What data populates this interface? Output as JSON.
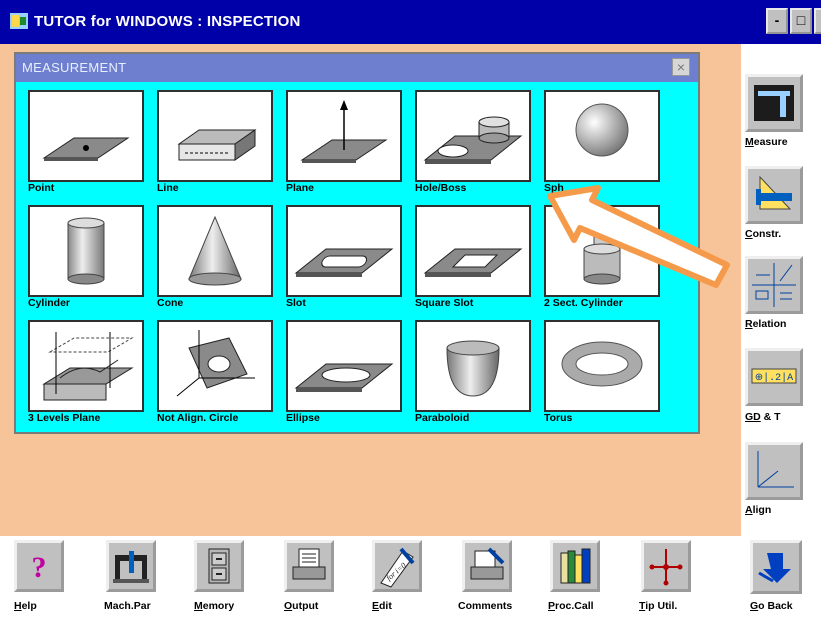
{
  "window": {
    "title": "TUTOR for WINDOWS : INSPECTION",
    "minimize_label": "-",
    "maximize_label": "□",
    "close_label": "×"
  },
  "measurement_panel": {
    "title": "MEASUREMENT",
    "close_label": "×",
    "tiles": [
      {
        "label": "Point",
        "icon": "point-icon"
      },
      {
        "label": "Line",
        "icon": "line-icon"
      },
      {
        "label": "Plane",
        "icon": "plane-icon"
      },
      {
        "label": "Hole/Boss",
        "icon": "hole-boss-icon"
      },
      {
        "label": "Sph",
        "icon": "sphere-icon"
      },
      {
        "label": "Cylinder",
        "icon": "cylinder-icon"
      },
      {
        "label": "Cone",
        "icon": "cone-icon"
      },
      {
        "label": "Slot",
        "icon": "slot-icon"
      },
      {
        "label": "Square Slot",
        "icon": "square-slot-icon"
      },
      {
        "label": "2 Sect. Cylinder",
        "icon": "two-section-cylinder-icon"
      },
      {
        "label": "3 Levels Plane",
        "icon": "three-levels-plane-icon"
      },
      {
        "label": "Not Align. Circle",
        "icon": "not-aligned-circle-icon"
      },
      {
        "label": "Ellipse",
        "icon": "ellipse-icon"
      },
      {
        "label": "Paraboloid",
        "icon": "paraboloid-icon"
      },
      {
        "label": "Torus",
        "icon": "torus-icon"
      }
    ]
  },
  "right_toolbar": [
    {
      "first": "M",
      "rest": "easure",
      "icon": "caliper-icon"
    },
    {
      "first": "C",
      "rest": "onstr.",
      "icon": "set-square-ruler-icon"
    },
    {
      "first": "R",
      "rest": "elation",
      "icon": "relation-icon"
    },
    {
      "first": "GD",
      "rest": " & T",
      "icon": "gdt-frame-icon",
      "frame_text": "⊕|.2|A"
    },
    {
      "first": "A",
      "rest": "lign",
      "icon": "axes-icon"
    }
  ],
  "bottom_toolbar": [
    {
      "first": "H",
      "rest": "elp",
      "icon": "question-icon"
    },
    {
      "first": "",
      "rest": "Mach.Par",
      "icon": "cmm-machine-icon"
    },
    {
      "first": "M",
      "rest": "emory",
      "icon": "filing-cabinet-icon"
    },
    {
      "first": "O",
      "rest": "utput",
      "icon": "printer-icon"
    },
    {
      "first": "E",
      "rest": "dit",
      "icon": "pen-paper-icon",
      "note": "for i=0"
    },
    {
      "first": "",
      "rest": "Comments",
      "icon": "comment-printer-icon"
    },
    {
      "first": "P",
      "rest": "roc.Call",
      "icon": "books-icon"
    },
    {
      "first": "T",
      "rest": "ip Util.",
      "icon": "probe-tip-icon"
    },
    {
      "first": "G",
      "rest": "o Back",
      "icon": "go-back-arrow-icon"
    }
  ],
  "colors": {
    "titlebar": "#0000a8",
    "desktop": "#f7c49a",
    "panel": "#00ffff",
    "panel_title": "#6f7fcf",
    "annotation_arrow": "#f59a4a"
  }
}
